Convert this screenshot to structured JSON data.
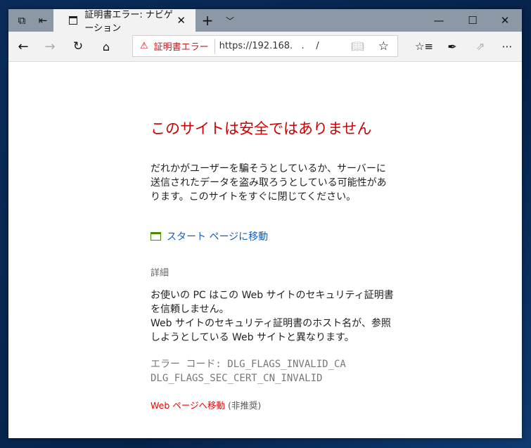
{
  "tab": {
    "title": "証明書エラー: ナビゲーション"
  },
  "address": {
    "warning": "証明書エラー",
    "url": "https://192.168.   .    /"
  },
  "page": {
    "heading": "このサイトは安全ではありません",
    "description": "だれかがユーザーを騙そうとしているか、サーバーに送信されたデータを盗み取ろうとしている可能性があります。このサイトをすぐに閉じてください。",
    "start_link": "スタート ページに移動",
    "details_label": "詳細",
    "details_line1": "お使いの PC はこの Web サイトのセキュリティ証明書を信頼しません。",
    "details_line2": "Web サイトのセキュリティ証明書のホスト名が、参照しようとしている Web サイトと異なります。",
    "error_code_line1": "エラー コード: DLG_FLAGS_INVALID_CA",
    "error_code_line2": "DLG_FLAGS_SEC_CERT_CN_INVALID",
    "proceed_link": "Web ページへ移動",
    "proceed_note": "(非推奨)"
  }
}
